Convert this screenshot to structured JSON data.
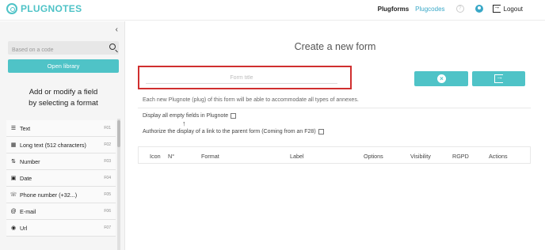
{
  "header": {
    "logo_text": "PLUGNOTES",
    "nav": {
      "plugforms": "Plugforms",
      "plugcodes": "Plugcodes",
      "logout": "Logout"
    }
  },
  "sidebar": {
    "search_placeholder": "Based on a code",
    "open_library": "Open library",
    "heading_line1": "Add or modify a field",
    "heading_line2": "by selecting a format",
    "fields": [
      {
        "icon": "text-icon",
        "label": "Text",
        "code": "F01"
      },
      {
        "icon": "long-text-icon",
        "label": "Long text (512 characters)",
        "code": "F02"
      },
      {
        "icon": "number-icon",
        "label": "Number",
        "code": "F03"
      },
      {
        "icon": "date-icon",
        "label": "Date",
        "code": "F04"
      },
      {
        "icon": "phone-icon",
        "label": "Phone number (+32...)",
        "code": "F05"
      },
      {
        "icon": "email-icon",
        "label": "E-mail",
        "code": "F06"
      },
      {
        "icon": "url-icon",
        "label": "Url",
        "code": "F07"
      }
    ]
  },
  "main": {
    "title": "Create a new form",
    "form_title_placeholder": "Form title",
    "info_text": "Each new Plugnote (plug) of this form will be able to accommodate all types of annexes.",
    "option_empty_fields": "Display all empty fields in Plugnote",
    "option_parent_link": "Authorize the display of a link to the parent form (Coming from an F28)",
    "table_headers": [
      "Icon",
      "N°",
      "Format",
      "Label",
      "Options",
      "Visibility",
      "RGPD",
      "Actions"
    ]
  },
  "colors": {
    "accent": "#4fc3c7",
    "highlight_border": "#d02f2f",
    "link_blue": "#3aa8c7"
  }
}
